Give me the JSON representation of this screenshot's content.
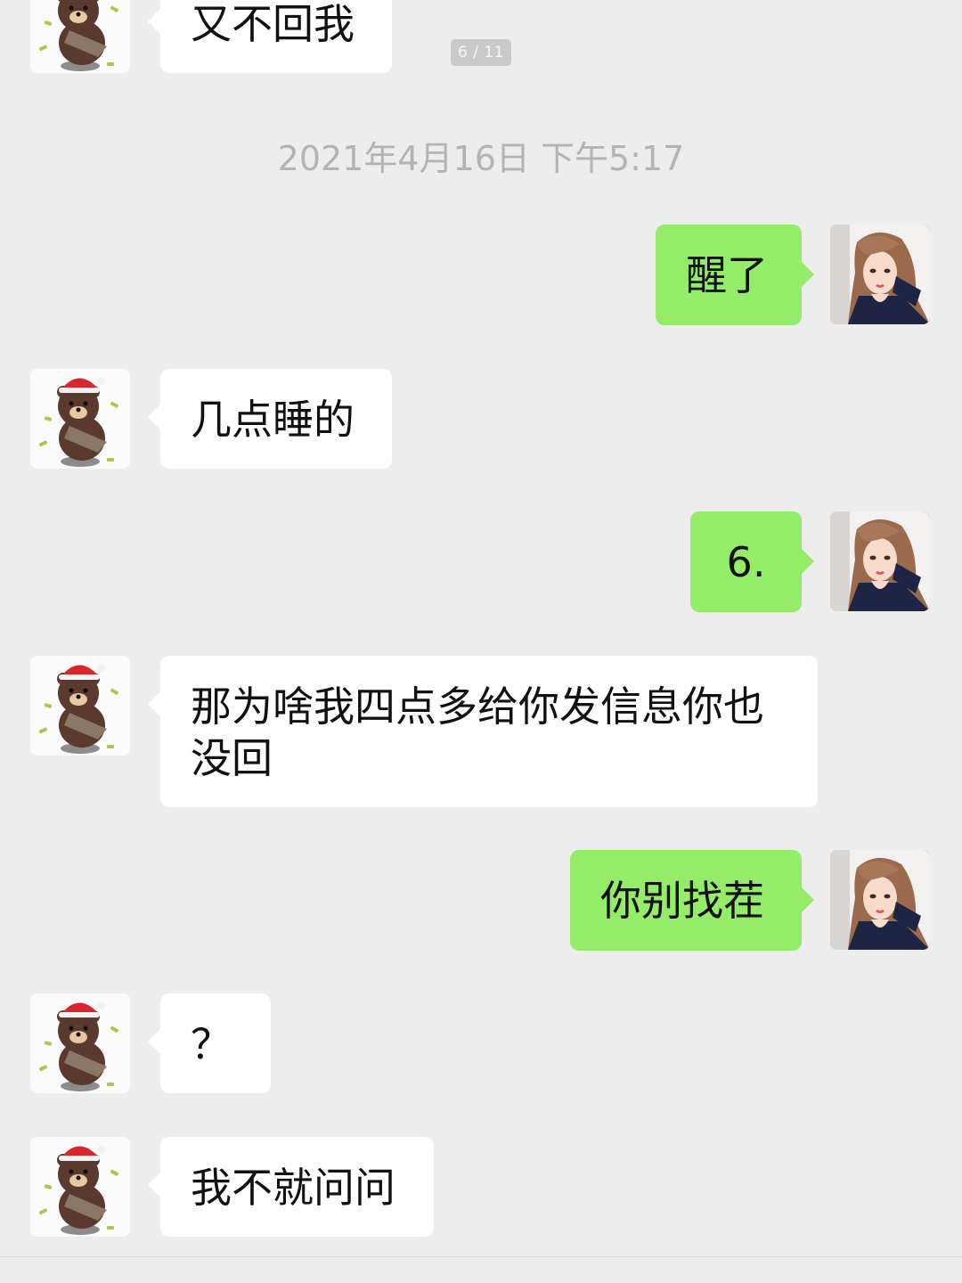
{
  "viewer": {
    "page_indicator": "6 / 11"
  },
  "chat": {
    "timestamp": "2021年4月16日 下午5:17",
    "messages": [
      {
        "from": "other",
        "text": "又不回我"
      },
      {
        "from": "me",
        "text": "醒了"
      },
      {
        "from": "other",
        "text": "几点睡的"
      },
      {
        "from": "me",
        "text": "6."
      },
      {
        "from": "other",
        "text": "那为啥我四点多给你发信息你也没回"
      },
      {
        "from": "me",
        "text": "你别找茬"
      },
      {
        "from": "other",
        "text": "？"
      },
      {
        "from": "other",
        "text": "我不就问问"
      }
    ]
  },
  "avatars": {
    "other": "brown-bear-santa-hat-avatar",
    "me": "illustrated-girl-portrait-avatar"
  },
  "colors": {
    "background": "#ededed",
    "incoming_bubble": "#ffffff",
    "outgoing_bubble": "#95ec69",
    "timestamp_text": "#b3b3b3"
  }
}
